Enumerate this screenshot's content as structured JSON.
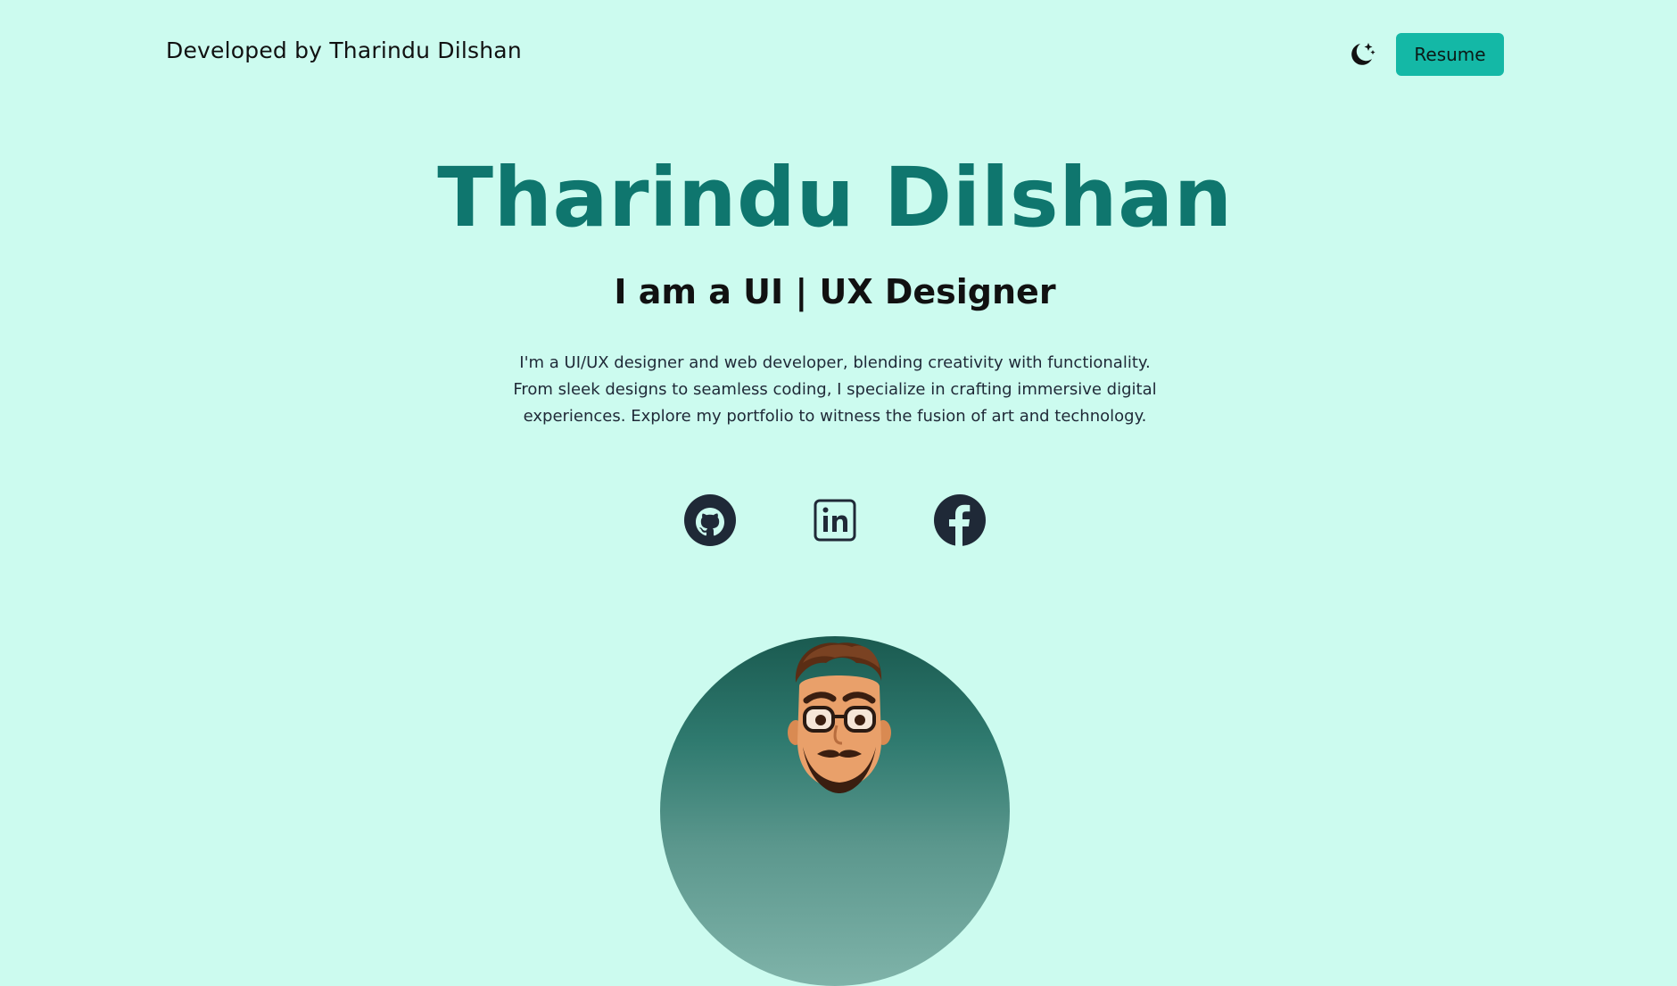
{
  "header": {
    "brand": "Developed by Tharindu Dilshan",
    "theme_toggle_icon": "moon-stars-icon",
    "resume_label": "Resume"
  },
  "hero": {
    "name": "Tharindu Dilshan",
    "role": "I am a UI | UX Designer",
    "description_lines": [
      "I'm a UI/UX designer and web developer, blending creativity with functionality.",
      "From sleek designs to seamless coding, I specialize in crafting immersive digital",
      "experiences. Explore my portfolio to witness the fusion of art and technology."
    ]
  },
  "social": [
    {
      "name": "GitHub",
      "icon": "github-icon"
    },
    {
      "name": "LinkedIn",
      "icon": "linkedin-icon"
    },
    {
      "name": "Facebook",
      "icon": "facebook-icon"
    }
  ],
  "colors": {
    "background": "#ccfbef",
    "accent": "#14b8a6",
    "name": "#0f766e",
    "icon": "#1f2937"
  },
  "avatar": {
    "icon": "cartoon-avatar"
  }
}
